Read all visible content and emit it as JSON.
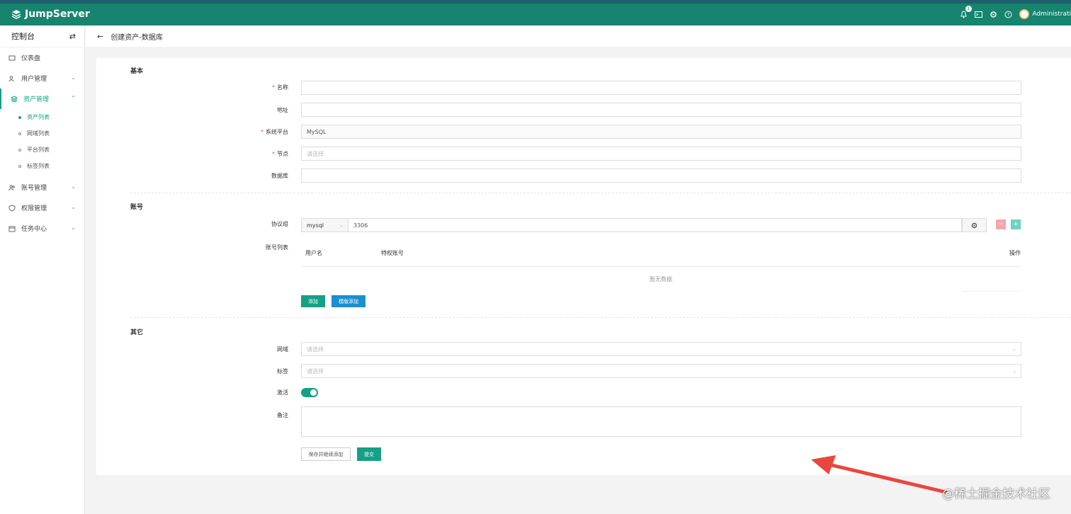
{
  "app": {
    "name": "JumpServer"
  },
  "topbar": {
    "notification_count": "1",
    "user": "Administrati"
  },
  "sidebar": {
    "title": "控制台",
    "items": [
      {
        "label": "仪表盘"
      },
      {
        "label": "用户管理"
      },
      {
        "label": "资产管理",
        "children": [
          "资产列表",
          "网域列表",
          "平台列表",
          "标签列表"
        ]
      },
      {
        "label": "账号管理"
      },
      {
        "label": "权限管理"
      },
      {
        "label": "任务中心"
      }
    ]
  },
  "page": {
    "title": "创建资产-数据库"
  },
  "form": {
    "basic": {
      "title": "基本",
      "name_label": "名称",
      "address_label": "地址",
      "platform_label": "系统平台",
      "platform_value": "MySQL",
      "node_label": "节点",
      "node_placeholder": "请选择",
      "database_label": "数据库"
    },
    "account": {
      "title": "账号",
      "protocol_label": "协议组",
      "protocol_value": "mysql",
      "port_value": "3306",
      "list_label": "账号列表",
      "columns": [
        "用户名",
        "特权账号",
        "操作"
      ],
      "empty_text": "暂无数据",
      "add_button": "添加",
      "template_add_button": "模版添加"
    },
    "other": {
      "title": "其它",
      "domain_label": "网域",
      "domain_placeholder": "请选择",
      "labels_label": "标签",
      "labels_placeholder": "请选择",
      "active_label": "激活",
      "comment_label": "备注"
    },
    "actions": {
      "save_continue": "保存并继续添加",
      "submit": "提交"
    }
  },
  "watermark": "@稀土掘金技术社区",
  "colors": {
    "primary": "#16846e",
    "accent": "#16a085",
    "blue": "#1b8fd1",
    "required": "#e35b5b"
  }
}
